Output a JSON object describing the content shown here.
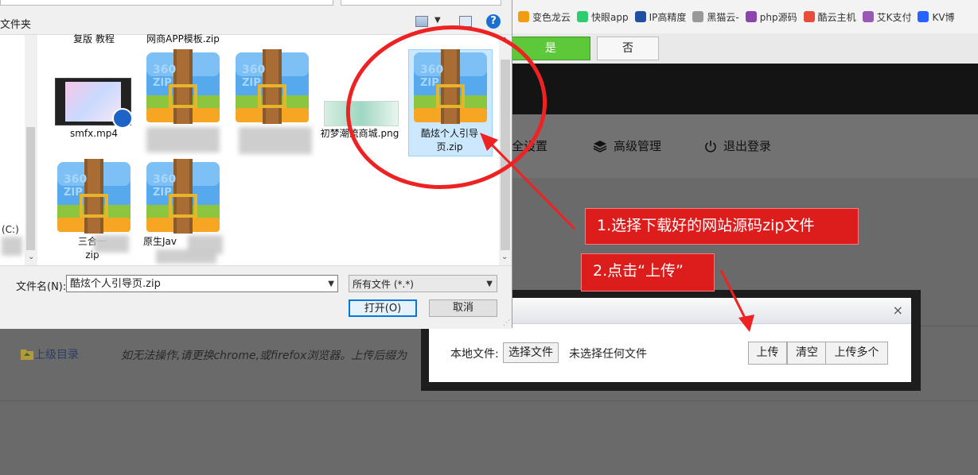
{
  "bookmarks": [
    {
      "label": "变色龙云",
      "color": "#f39c12"
    },
    {
      "label": "快眼app",
      "color": "#2ecc71"
    },
    {
      "label": "IP高精度",
      "color": "#1f4fa3"
    },
    {
      "label": "黑猫云-",
      "color": "#999999"
    },
    {
      "label": "php源码",
      "color": "#8e44ad"
    },
    {
      "label": "酷云主机",
      "color": "#e74c3c"
    },
    {
      "label": "艾K支付",
      "color": "#9b59b6"
    },
    {
      "label": "KV博",
      "color": "#2962ff"
    }
  ],
  "confirm": {
    "yes": "是",
    "no": "否"
  },
  "site_nav": {
    "security": "全设置",
    "advanced": "高级管理",
    "logout": "退出登录"
  },
  "page": {
    "up_dir": "上级目录",
    "hint": "如无法操作,请更换chrome,或firefox浏览器。上传后缀为"
  },
  "upload_modal": {
    "close": "×",
    "local_file_label": "本地文件:",
    "choose_file": "选择文件",
    "no_file": "未选择任何文件",
    "upload": "上传",
    "clear": "清空",
    "upload_multi": "上传多个"
  },
  "annotations": {
    "step1": "1.选择下载好的网站源码zip文件",
    "step2": "2.点击“上传”"
  },
  "file_dialog": {
    "new_folder": "文件夹",
    "help": "?",
    "drive": "(C:)",
    "files": [
      {
        "label": "复版 教程"
      },
      {
        "label": "网商APP模板.zip"
      },
      {
        "label": "smfx.mp4"
      },
      {
        "label": "初梦潮流商城.png"
      },
      {
        "label": "酷炫个人引导页.zip"
      },
      {
        "label": "三合一",
        "suffix": "zip"
      },
      {
        "label": "原生Jav"
      }
    ],
    "filename_label": "文件名(N):",
    "filename_value": "酷炫个人引导页.zip",
    "filetype_value": "所有文件 (*.*)",
    "open": "打开(O)",
    "cancel": "取消"
  },
  "colors": {
    "accent_green": "#5cc83a",
    "annotation_red": "#dd1c1c",
    "selection_blue": "#cce8ff"
  }
}
